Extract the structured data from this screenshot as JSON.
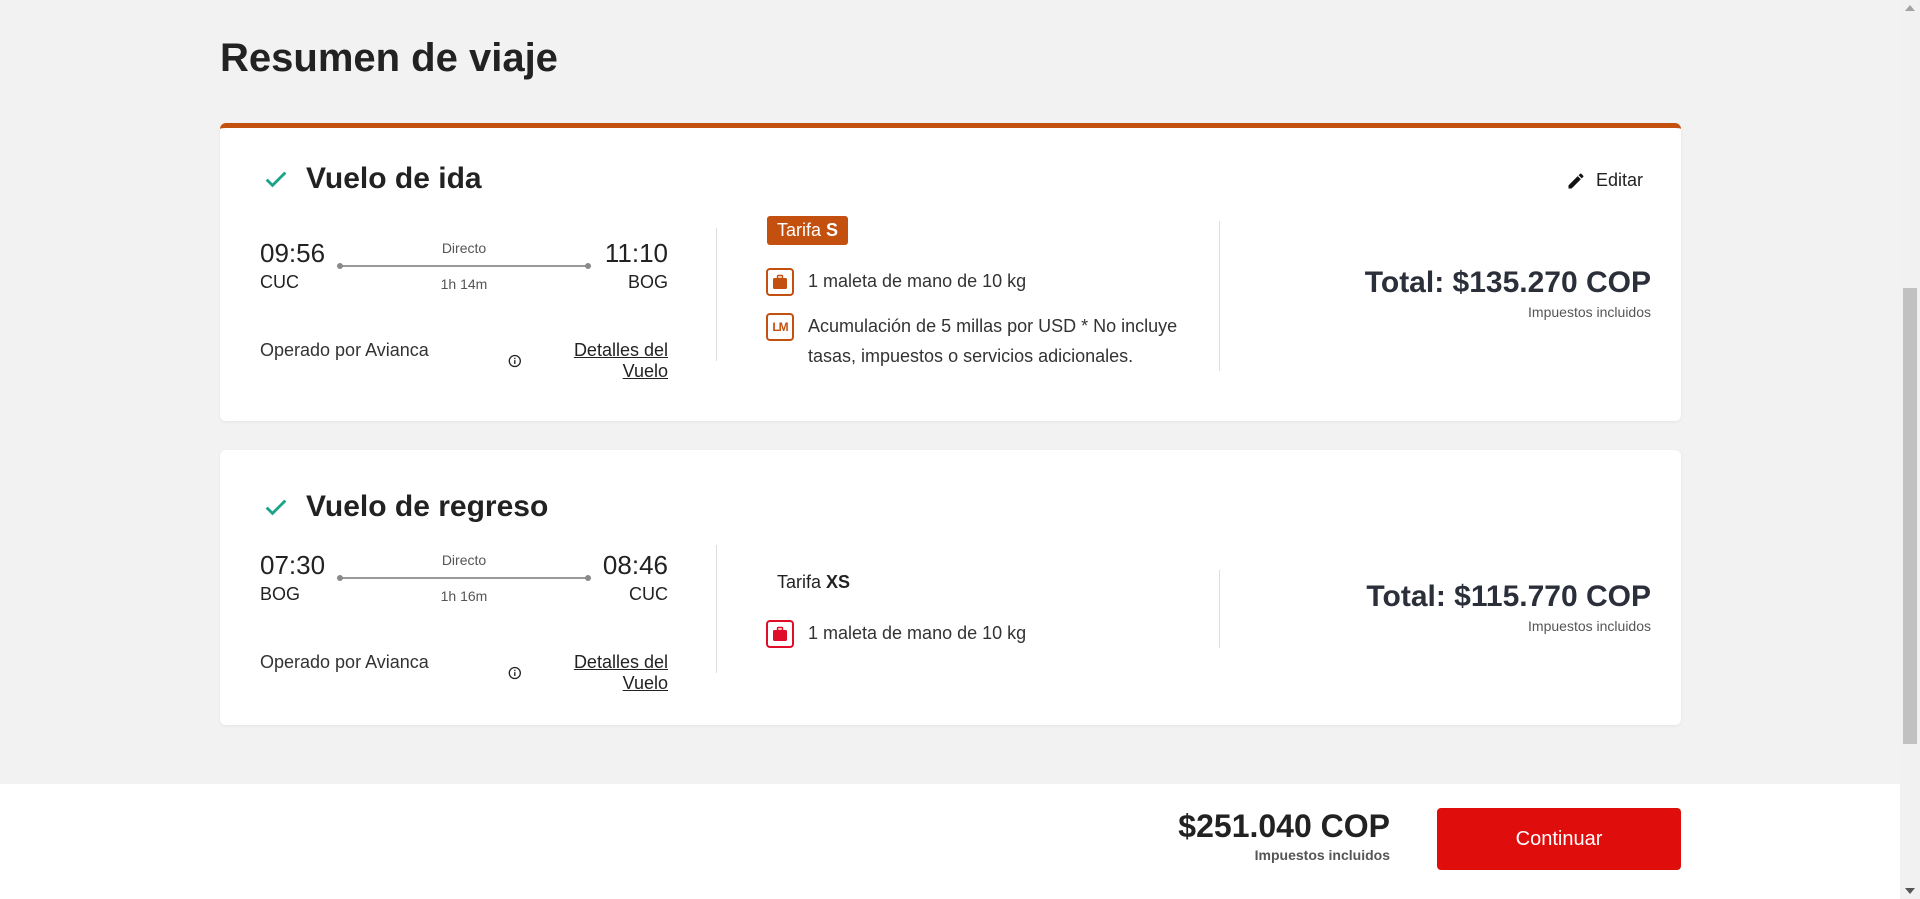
{
  "page": {
    "title": "Resumen de viaje"
  },
  "outbound": {
    "title": "Vuelo de ida",
    "edit_label": "Editar",
    "depart_time": "09:56",
    "depart_code": "CUC",
    "arrive_time": "11:10",
    "arrive_code": "BOG",
    "stops": "Directo",
    "duration": "1h 14m",
    "operated": "Operado por Avianca",
    "details_label": "Detalles del Vuelo",
    "fare_prefix": "Tarifa",
    "fare_name": "S",
    "benefit_bag": "1 maleta de mano de 10 kg",
    "benefit_miles": "Acumulación de 5 millas por USD * No incluye tasas, impuestos o servicios adicionales.",
    "miles_icon_text": "LM",
    "total": "Total: $135.270 COP",
    "tax_note": "Impuestos incluidos"
  },
  "return": {
    "title": "Vuelo de regreso",
    "depart_time": "07:30",
    "depart_code": "BOG",
    "arrive_time": "08:46",
    "arrive_code": "CUC",
    "stops": "Directo",
    "duration": "1h 16m",
    "operated": "Operado por Avianca",
    "details_label": "Detalles del Vuelo",
    "fare_prefix": "Tarifa",
    "fare_name": "XS",
    "benefit_bag": "1 maleta de mano de 10 kg",
    "total": "Total: $115.770 COP",
    "tax_note": "Impuestos incluidos"
  },
  "footer": {
    "grand_total": "$251.040 COP",
    "tax_note": "Impuestos incluidos",
    "continue_label": "Continuar"
  },
  "colors": {
    "accent_orange": "#c4500f",
    "check_teal": "#1aa38b",
    "cta_red": "#e00d0d",
    "bag_red": "#e00d2a"
  },
  "icons": [
    "check-icon",
    "pencil-icon",
    "info-icon",
    "suitcase-icon",
    "lifemiles-icon"
  ]
}
